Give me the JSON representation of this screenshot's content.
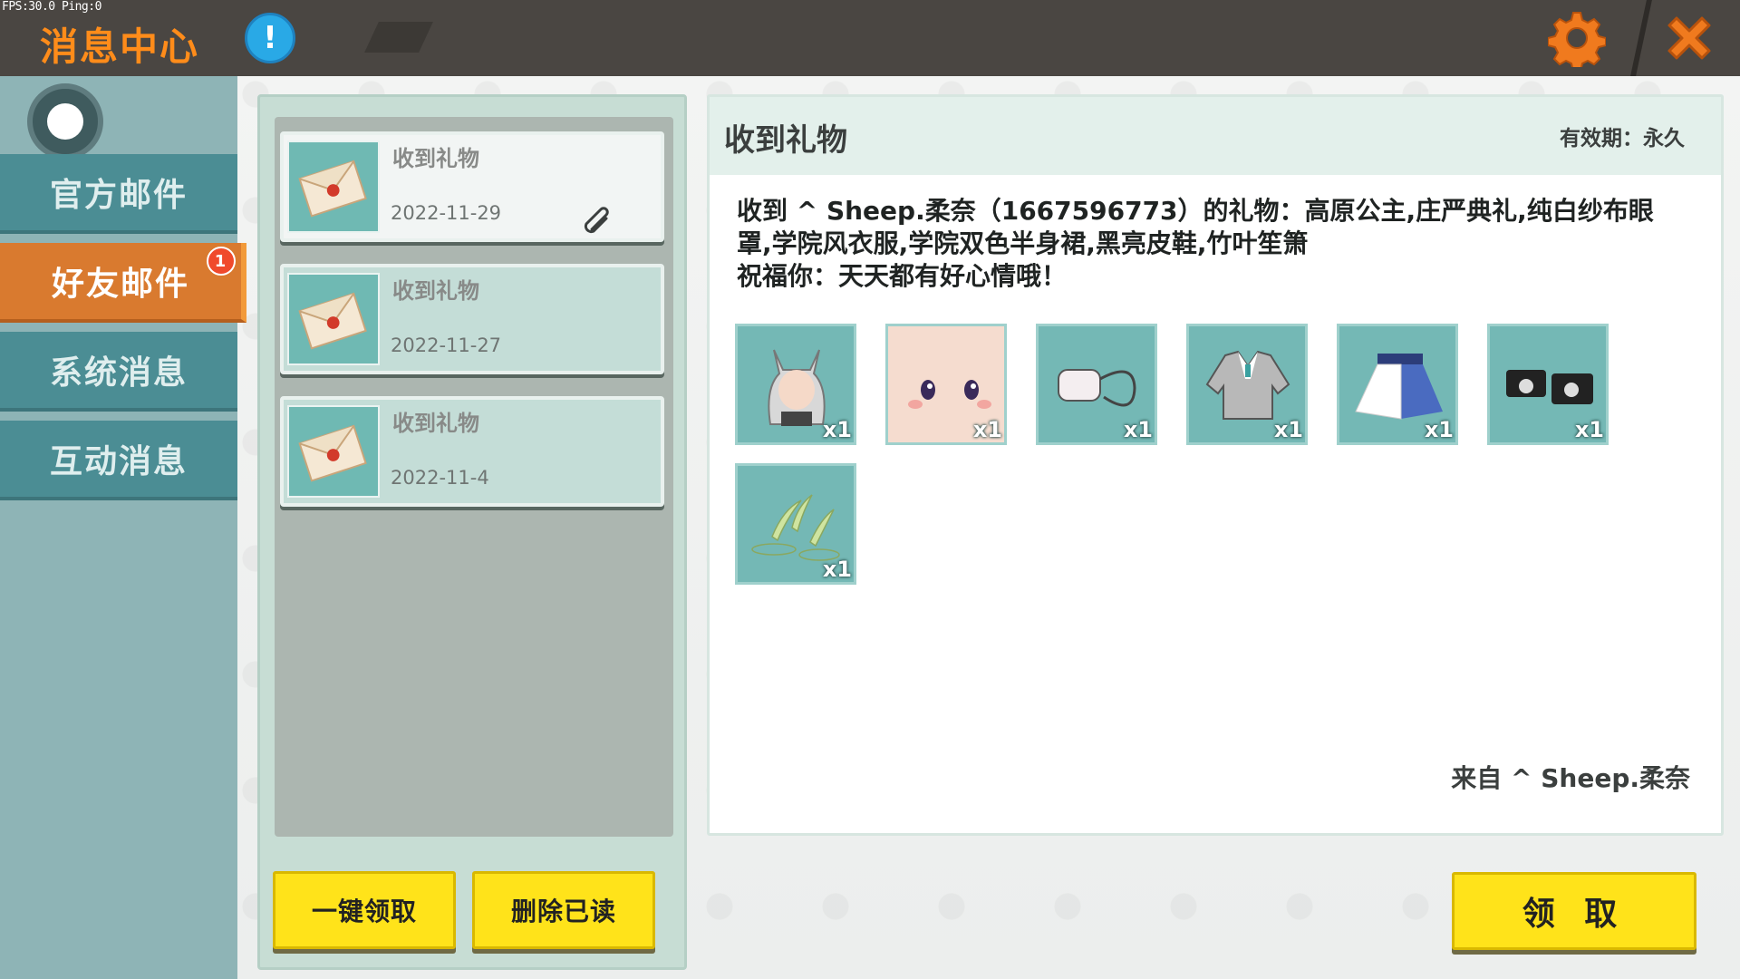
{
  "overlay": {
    "fps_text": "FPS:30.0  Ping:0"
  },
  "header": {
    "title": "消息中心",
    "info_icon": "!"
  },
  "sidebar": {
    "tabs": [
      {
        "label": "官方邮件",
        "active": false
      },
      {
        "label": "好友邮件",
        "active": true,
        "badge": "1"
      },
      {
        "label": "系统消息",
        "active": false
      },
      {
        "label": "互动消息",
        "active": false
      }
    ]
  },
  "mail_list": {
    "items": [
      {
        "subject": "收到礼物",
        "date": "2022-11-29",
        "selected": true,
        "has_attachment": true
      },
      {
        "subject": "收到礼物",
        "date": "2022-11-27",
        "selected": false,
        "has_attachment": false
      },
      {
        "subject": "收到礼物",
        "date": "2022-11-4",
        "selected": false,
        "has_attachment": false
      }
    ],
    "claim_all_label": "一键领取",
    "delete_read_label": "删除已读"
  },
  "detail": {
    "title": "收到礼物",
    "validity": "有效期：永久",
    "message_line1": "收到 ^ Sheep.柔奈（1667596773）的礼物：高原公主,庄严典礼,纯白纱布眼",
    "message_line2": "罩,学院风衣服,学院双色半身裙,黑亮皮鞋,竹叶笙箫",
    "message_line3": "祝福你：天天都有好心情哦！",
    "items": [
      {
        "icon": "cat-ear-hair-icon",
        "qty": "x1"
      },
      {
        "icon": "face-icon",
        "qty": "x1"
      },
      {
        "icon": "eye-mask-icon",
        "qty": "x1"
      },
      {
        "icon": "school-jacket-icon",
        "qty": "x1"
      },
      {
        "icon": "two-tone-skirt-icon",
        "qty": "x1"
      },
      {
        "icon": "black-shoes-icon",
        "qty": "x1"
      },
      {
        "icon": "bamboo-leaf-icon",
        "qty": "x1"
      }
    ],
    "sender": "来自 ^ Sheep.柔奈",
    "claim_label": "领 取"
  },
  "colors": {
    "topbar": "#4a4642",
    "title_orange": "#ff8c1a",
    "tab_teal": "#4b8d94",
    "tab_active_orange": "#d97a2f",
    "button_yellow": "#ffe31a",
    "item_teal": "#74b8b5"
  }
}
